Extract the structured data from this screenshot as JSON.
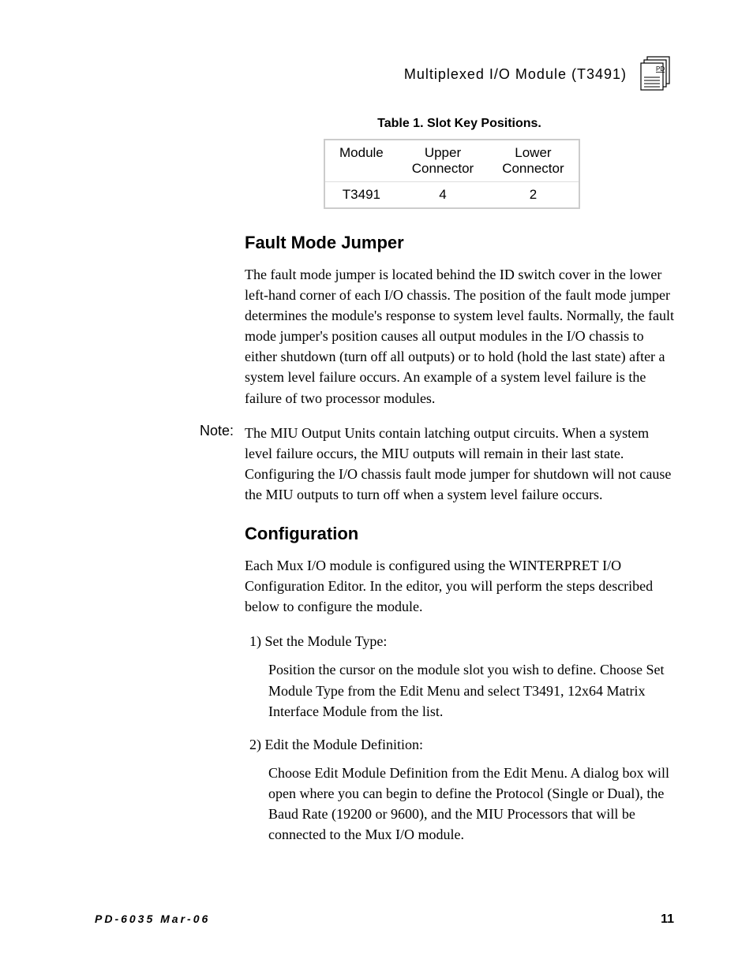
{
  "header": {
    "title": "Multiplexed I/O Module (T3491)",
    "icon_label": "PD"
  },
  "table": {
    "caption": "Table 1.  Slot Key Positions.",
    "headers": {
      "c1": "Module",
      "c2": "Upper Connector",
      "c3": "Lower Connector"
    },
    "row": {
      "c1": "T3491",
      "c2": "4",
      "c3": "2"
    }
  },
  "sections": {
    "fault": {
      "heading": "Fault Mode Jumper",
      "para1": "The fault mode jumper is located behind the ID switch cover in the lower left-hand corner of each I/O chassis.  The position of the fault mode jumper determines the module's response to system level faults.  Normally, the fault mode jumper's position causes all output modules in the I/O chassis to either shutdown (turn off all outputs) or to hold (hold the last state) after a system level failure occurs.  An example of a system level failure is the failure of two processor modules.",
      "note_label": "Note:",
      "note_text": "The MIU Output Units contain latching output circuits.  When a system level failure occurs, the MIU outputs will remain in their last state.  Configuring the I/O chassis fault mode jumper for shutdown will not cause the MIU outputs to turn off when a system level failure occurs."
    },
    "config": {
      "heading": "Configuration",
      "intro_a": "Each Mux I/O module is configured using the W",
      "intro_b": "INTERPRET",
      "intro_c": " I/O Configuration Editor.  In the editor, you will perform the steps described below to configure the module.",
      "step1_label": "1) Set the Module Type:",
      "step1_body": "Position the cursor on the module slot you wish to define.  Choose Set Module Type from the Edit Menu and select T3491, 12x64 Matrix Interface Module from the list.",
      "step2_label": "2) Edit the Module Definition:",
      "step2_body": "Choose Edit Module Definition from the Edit Menu.  A dialog box will open where you can begin to define the Protocol (Single or Dual), the Baud Rate (19200 or 9600), and the MIU Processors that will be connected to the Mux I/O module."
    }
  },
  "footer": {
    "left": "PD-6035 Mar-06",
    "right": "11"
  }
}
